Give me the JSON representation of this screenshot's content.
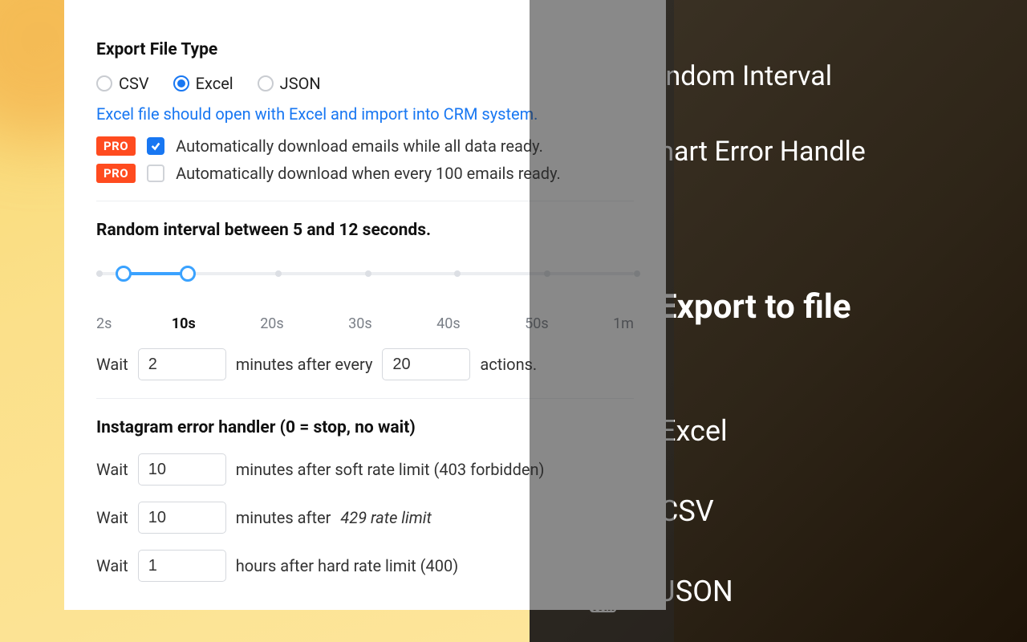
{
  "settings": {
    "export_title": "Export File Type",
    "radios": {
      "csv": "CSV",
      "excel": "Excel",
      "json": "JSON"
    },
    "selected_radio": "excel",
    "excel_hint": "Excel file should open with Excel and import into CRM system.",
    "pro_badge": "PRO",
    "auto_download_all": "Automatically download emails while all data ready.",
    "auto_download_every": "Automatically download when every 100 emails ready.",
    "interval_title": "Random interval between 5 and 12 seconds.",
    "slider_ticks": [
      "2s",
      "10s",
      "20s",
      "30s",
      "40s",
      "50s",
      "1m"
    ],
    "wait": {
      "label_wait": "Wait",
      "minutes_after_every": "minutes after every",
      "actions": "actions.",
      "minutes_val": "2",
      "actions_val": "20"
    },
    "error_title": "Instagram error handler (0 = stop, no wait)",
    "err_soft": {
      "val": "10",
      "text": "minutes after soft rate limit (403 forbidden)"
    },
    "err_429": {
      "val": "10",
      "text_a": "minutes after",
      "text_b": "429 rate limit"
    },
    "err_hard": {
      "val": "1",
      "text": "hours after hard rate limit (400)"
    }
  },
  "promo": {
    "random_interval": "Random Interval",
    "smart_error": "Smart Error Handle",
    "export_title": "Export to file",
    "excel": "Excel",
    "csv": "CSV",
    "json": "JSON"
  }
}
